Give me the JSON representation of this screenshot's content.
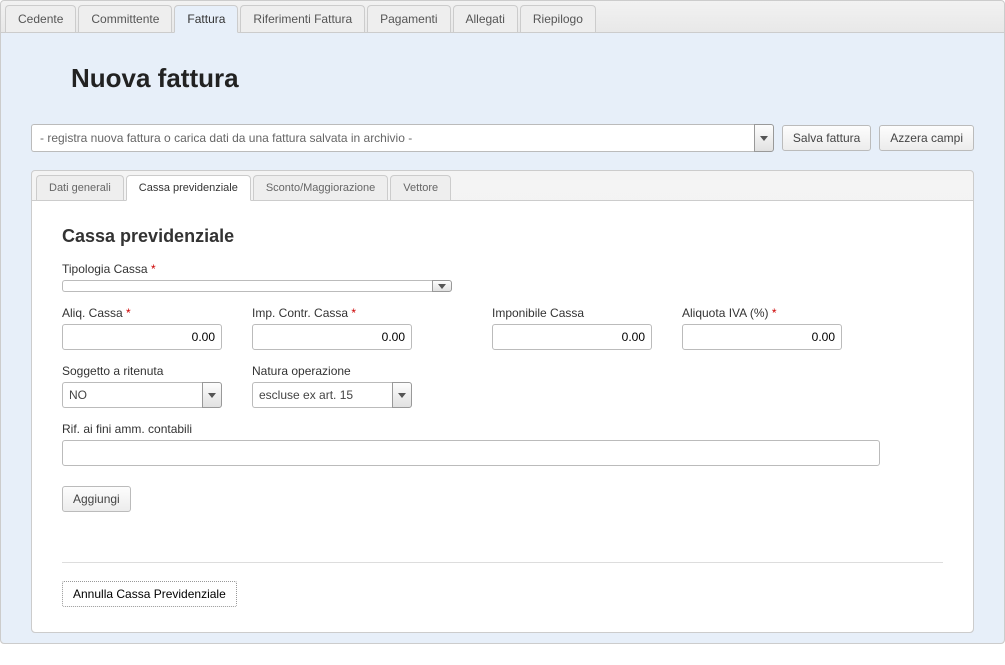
{
  "topTabs": [
    {
      "label": "Cedente"
    },
    {
      "label": "Committente"
    },
    {
      "label": "Fattura"
    },
    {
      "label": "Riferimenti Fattura"
    },
    {
      "label": "Pagamenti"
    },
    {
      "label": "Allegati"
    },
    {
      "label": "Riepilogo"
    }
  ],
  "pageTitle": "Nuova fattura",
  "archivePlaceholder": "- registra nuova fattura o carica dati da una fattura salvata in archivio -",
  "buttons": {
    "save": "Salva fattura",
    "reset": "Azzera campi",
    "add": "Aggiungi",
    "cancel": "Annulla Cassa Previdenziale"
  },
  "innerTabs": [
    {
      "label": "Dati generali"
    },
    {
      "label": "Cassa previdenziale"
    },
    {
      "label": "Sconto/Maggiorazione"
    },
    {
      "label": "Vettore"
    }
  ],
  "sectionTitle": "Cassa previdenziale",
  "fields": {
    "tipologia": {
      "label": "Tipologia Cassa",
      "req": "*",
      "value": ""
    },
    "aliqCassa": {
      "label": "Aliq. Cassa",
      "req": "*",
      "value": "0.00"
    },
    "impContr": {
      "label": "Imp. Contr. Cassa",
      "req": "*",
      "value": "0.00"
    },
    "imponibile": {
      "label": "Imponibile Cassa",
      "req": "",
      "value": "0.00"
    },
    "aliquotaIva": {
      "label": "Aliquota IVA (%)",
      "req": "*",
      "value": "0.00"
    },
    "soggRitenuta": {
      "label": "Soggetto a ritenuta",
      "value": "NO"
    },
    "natura": {
      "label": "Natura operazione",
      "value": "escluse ex art. 15"
    },
    "rifAmm": {
      "label": "Rif. ai fini amm. contabili",
      "value": ""
    }
  }
}
